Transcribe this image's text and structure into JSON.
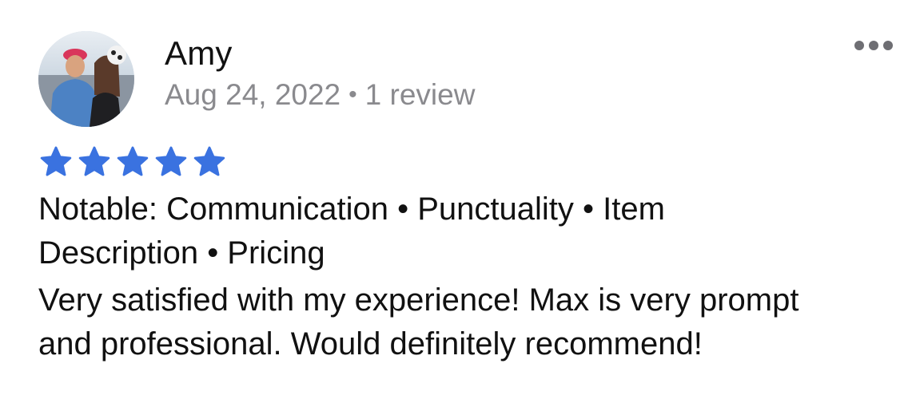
{
  "review": {
    "reviewer_name": "Amy",
    "date": "Aug 24, 2022",
    "separator": "•",
    "review_count": "1 review",
    "rating": 5,
    "rating_max": 5,
    "star_color": "#3a72e0",
    "notable_line1": "Notable: Communication • Punctuality • Item",
    "notable_line2": "Description • Pricing",
    "text_line1": "Very satisfied with my experience! Max is very prompt",
    "text_line2": "and professional. Would definitely recommend!"
  },
  "icons": {
    "more": "more-horizontal-icon",
    "star": "star-icon"
  }
}
